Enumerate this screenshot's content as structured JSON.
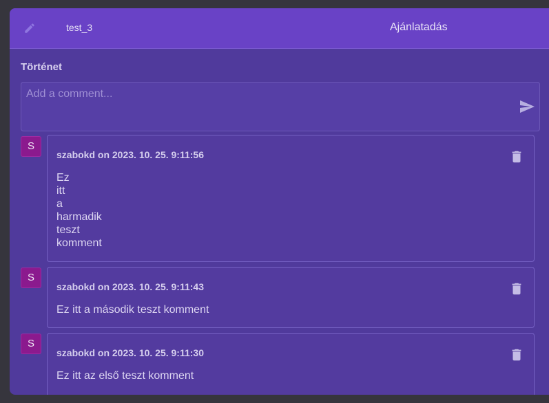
{
  "header": {
    "record_name": "test_3",
    "status_title": "Ajánlatadás",
    "edit_icon": "pencil-icon"
  },
  "history": {
    "section_title": "Történet",
    "comment_placeholder": "Add a comment...",
    "send_icon": "send-icon"
  },
  "comments": [
    {
      "avatar_letter": "S",
      "meta": "szabokd on 2023. 10. 25. 9:11:56",
      "body": "Ez\nitt\na\nharmadik\nteszt\nkomment"
    },
    {
      "avatar_letter": "S",
      "meta": "szabokd on 2023. 10. 25. 9:11:43",
      "body": "Ez itt a második teszt komment"
    },
    {
      "avatar_letter": "S",
      "meta": "szabokd on 2023. 10. 25. 9:11:30",
      "body": "Ez itt az első teszt komment"
    }
  ],
  "colors": {
    "header_bg": "#6942c6",
    "panel_bg": "#503a9c",
    "avatar_bg": "#8b1a8e"
  }
}
